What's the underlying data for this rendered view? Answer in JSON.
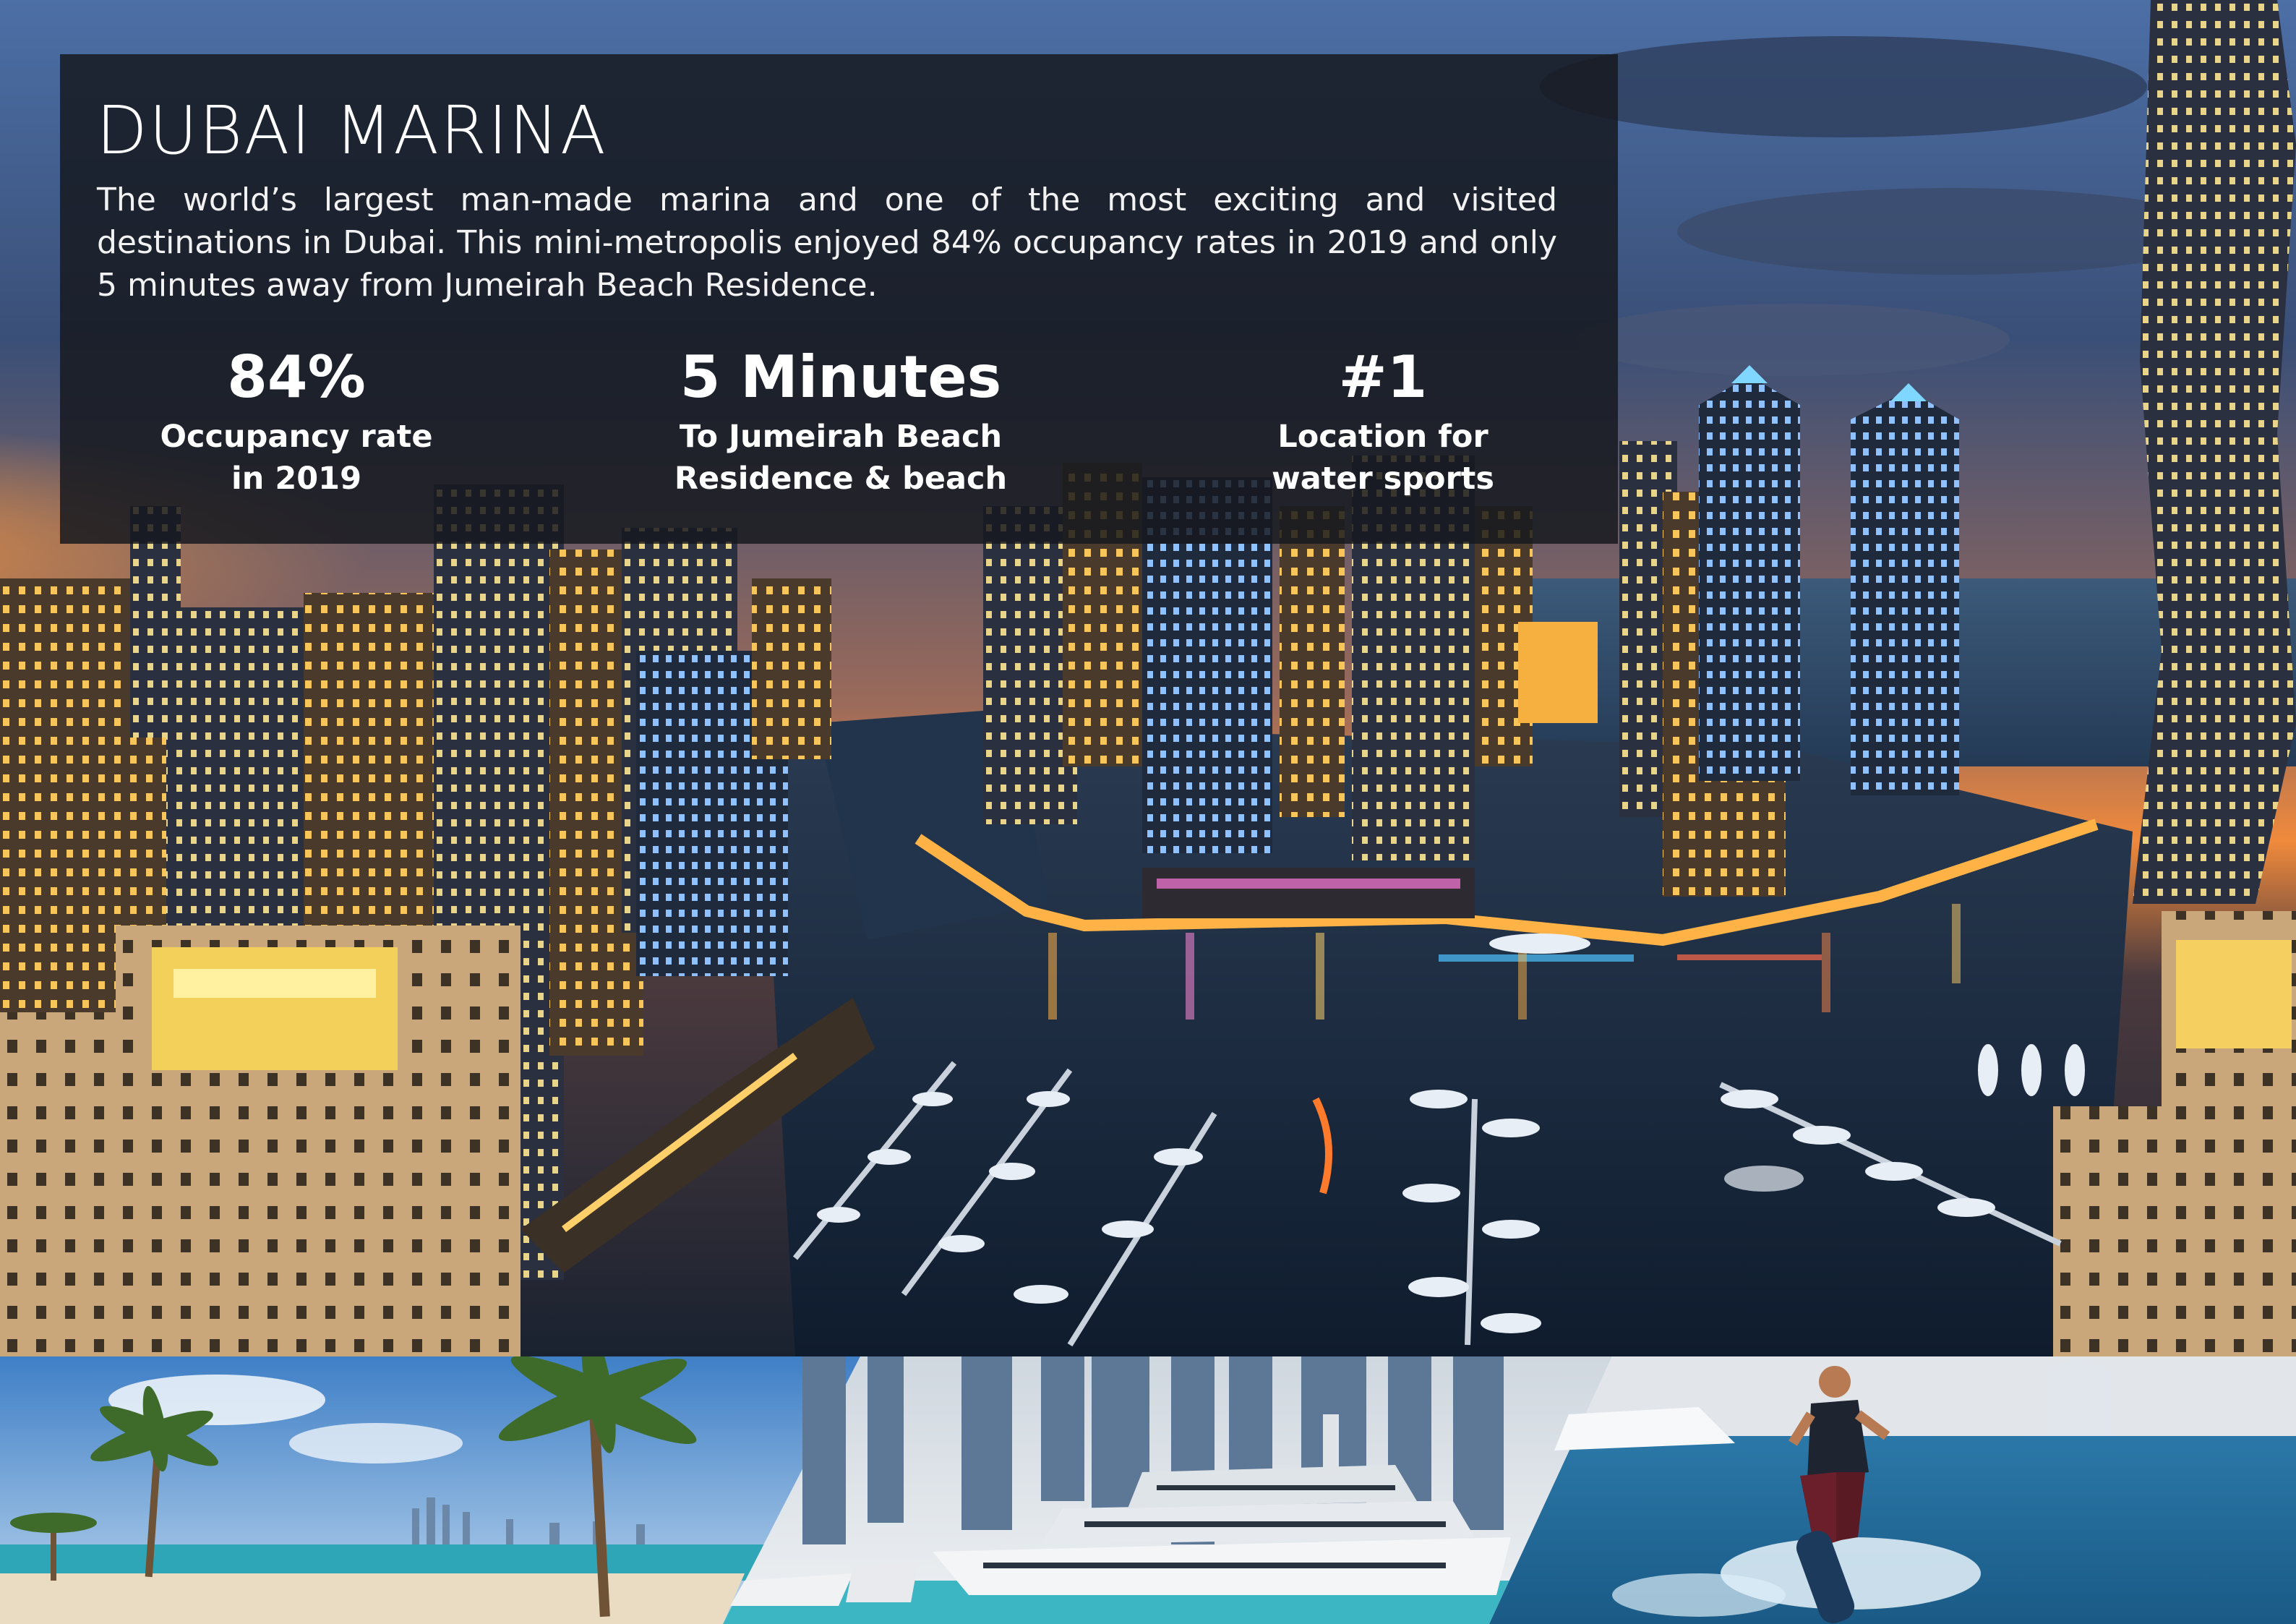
{
  "title": "DUBAI MARINA",
  "description": "The world’s largest man-made marina and one of the most exciting and visited destinations in Dubai.  This mini-metropolis enjoyed 84% occupancy rates in 2019 and only 5 minutes away from Jumeirah Beach Residence.",
  "stats": [
    {
      "value": "84%",
      "label_line1": "Occupancy rate",
      "label_line2": "in 2019"
    },
    {
      "value": "5 Minutes",
      "label_line1": "To Jumeirah Beach",
      "label_line2": "Residence & beach"
    },
    {
      "value": "#1",
      "label_line1": "Location for",
      "label_line2": "water sports"
    }
  ],
  "colors": {
    "panel_background": "#16181e",
    "text": "#ffffff",
    "dusk_sky_top": "#4c6fa6",
    "sunset_glow": "#f08a3c",
    "marina_water": "#16283f"
  },
  "photos": {
    "hero": "dubai-marina-night-aerial",
    "strip": [
      "beach-with-palm-trees",
      "superyacht-in-marina",
      "wakeboarder-on-sea"
    ]
  }
}
